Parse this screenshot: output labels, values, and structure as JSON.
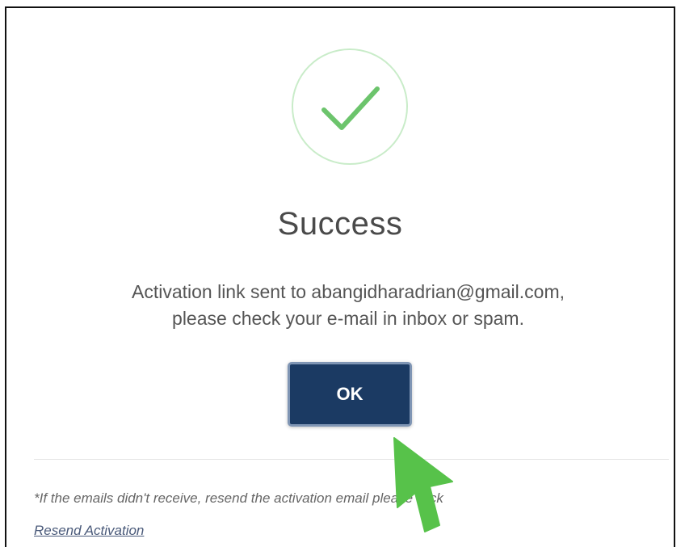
{
  "dialog": {
    "title": "Success",
    "message_line1": "Activation link sent to abangidharadrian@gmail.com,",
    "message_line2": "please check your e-mail in inbox or spam.",
    "ok_label": "OK",
    "note_text": "*If the emails didn't receive, resend the activation email please click",
    "resend_link_label": "Resend Activation"
  },
  "icons": {
    "status_icon": "check-icon",
    "pointer_icon": "arrow-pointer-icon"
  },
  "colors": {
    "success_green": "#6cc46c",
    "success_ring": "#c9ecc9",
    "button_navy": "#1b3a63",
    "pointer_green": "#57c24a"
  }
}
